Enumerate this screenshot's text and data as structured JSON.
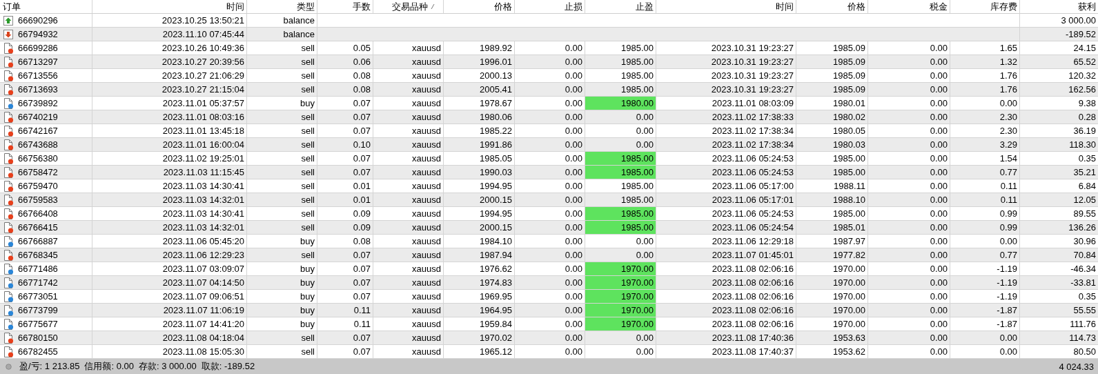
{
  "columns": [
    "订单",
    "时间",
    "类型",
    "手数",
    "交易品种",
    "价格",
    "止损",
    "止盈",
    "时间",
    "价格",
    "税金",
    "库存费",
    "获利"
  ],
  "rows": [
    {
      "kind": "deposit",
      "order": "66690296",
      "time": "2023.10.25 13:50:21",
      "type": "balance",
      "profit": "3 000.00"
    },
    {
      "kind": "withdrawal",
      "order": "66794932",
      "time": "2023.11.10 07:45:44",
      "type": "balance",
      "profit": "-189.52"
    },
    {
      "kind": "trade",
      "color": "#e8401c",
      "order": "66699286",
      "time": "2023.10.26 10:49:36",
      "type": "sell",
      "lots": "0.05",
      "symbol": "xauusd",
      "price": "1989.92",
      "sl": "0.00",
      "tp": "1985.00",
      "tp_hit": false,
      "close_time": "2023.10.31 19:23:27",
      "close_price": "1985.09",
      "tax": "0.00",
      "swap": "1.65",
      "profit": "24.15"
    },
    {
      "kind": "trade",
      "color": "#e8401c",
      "order": "66713297",
      "time": "2023.10.27 20:39:56",
      "type": "sell",
      "lots": "0.06",
      "symbol": "xauusd",
      "price": "1996.01",
      "sl": "0.00",
      "tp": "1985.00",
      "tp_hit": false,
      "close_time": "2023.10.31 19:23:27",
      "close_price": "1985.09",
      "tax": "0.00",
      "swap": "1.32",
      "profit": "65.52"
    },
    {
      "kind": "trade",
      "color": "#e8401c",
      "order": "66713556",
      "time": "2023.10.27 21:06:29",
      "type": "sell",
      "lots": "0.08",
      "symbol": "xauusd",
      "price": "2000.13",
      "sl": "0.00",
      "tp": "1985.00",
      "tp_hit": false,
      "close_time": "2023.10.31 19:23:27",
      "close_price": "1985.09",
      "tax": "0.00",
      "swap": "1.76",
      "profit": "120.32"
    },
    {
      "kind": "trade",
      "color": "#e8401c",
      "order": "66713693",
      "time": "2023.10.27 21:15:04",
      "type": "sell",
      "lots": "0.08",
      "symbol": "xauusd",
      "price": "2005.41",
      "sl": "0.00",
      "tp": "1985.00",
      "tp_hit": false,
      "close_time": "2023.10.31 19:23:27",
      "close_price": "1985.09",
      "tax": "0.00",
      "swap": "1.76",
      "profit": "162.56"
    },
    {
      "kind": "trade",
      "color": "#2a86d8",
      "order": "66739892",
      "time": "2023.11.01 05:37:57",
      "type": "buy",
      "lots": "0.07",
      "symbol": "xauusd",
      "price": "1978.67",
      "sl": "0.00",
      "tp": "1980.00",
      "tp_hit": true,
      "close_time": "2023.11.01 08:03:09",
      "close_price": "1980.01",
      "tax": "0.00",
      "swap": "0.00",
      "profit": "9.38"
    },
    {
      "kind": "trade",
      "color": "#e8401c",
      "order": "66740219",
      "time": "2023.11.01 08:03:16",
      "type": "sell",
      "lots": "0.07",
      "symbol": "xauusd",
      "price": "1980.06",
      "sl": "0.00",
      "tp": "0.00",
      "tp_hit": false,
      "close_time": "2023.11.02 17:38:33",
      "close_price": "1980.02",
      "tax": "0.00",
      "swap": "2.30",
      "profit": "0.28"
    },
    {
      "kind": "trade",
      "color": "#e8401c",
      "order": "66742167",
      "time": "2023.11.01 13:45:18",
      "type": "sell",
      "lots": "0.07",
      "symbol": "xauusd",
      "price": "1985.22",
      "sl": "0.00",
      "tp": "0.00",
      "tp_hit": false,
      "close_time": "2023.11.02 17:38:34",
      "close_price": "1980.05",
      "tax": "0.00",
      "swap": "2.30",
      "profit": "36.19"
    },
    {
      "kind": "trade",
      "color": "#e8401c",
      "order": "66743688",
      "time": "2023.11.01 16:00:04",
      "type": "sell",
      "lots": "0.10",
      "symbol": "xauusd",
      "price": "1991.86",
      "sl": "0.00",
      "tp": "0.00",
      "tp_hit": false,
      "close_time": "2023.11.02 17:38:34",
      "close_price": "1980.03",
      "tax": "0.00",
      "swap": "3.29",
      "profit": "118.30"
    },
    {
      "kind": "trade",
      "color": "#e8401c",
      "order": "66756380",
      "time": "2023.11.02 19:25:01",
      "type": "sell",
      "lots": "0.07",
      "symbol": "xauusd",
      "price": "1985.05",
      "sl": "0.00",
      "tp": "1985.00",
      "tp_hit": true,
      "close_time": "2023.11.06 05:24:53",
      "close_price": "1985.00",
      "tax": "0.00",
      "swap": "1.54",
      "profit": "0.35"
    },
    {
      "kind": "trade",
      "color": "#e8401c",
      "order": "66758472",
      "time": "2023.11.03 11:15:45",
      "type": "sell",
      "lots": "0.07",
      "symbol": "xauusd",
      "price": "1990.03",
      "sl": "0.00",
      "tp": "1985.00",
      "tp_hit": true,
      "close_time": "2023.11.06 05:24:53",
      "close_price": "1985.00",
      "tax": "0.00",
      "swap": "0.77",
      "profit": "35.21"
    },
    {
      "kind": "trade",
      "color": "#e8401c",
      "order": "66759470",
      "time": "2023.11.03 14:30:41",
      "type": "sell",
      "lots": "0.01",
      "symbol": "xauusd",
      "price": "1994.95",
      "sl": "0.00",
      "tp": "1985.00",
      "tp_hit": false,
      "close_time": "2023.11.06 05:17:00",
      "close_price": "1988.11",
      "tax": "0.00",
      "swap": "0.11",
      "profit": "6.84"
    },
    {
      "kind": "trade",
      "color": "#e8401c",
      "order": "66759583",
      "time": "2023.11.03 14:32:01",
      "type": "sell",
      "lots": "0.01",
      "symbol": "xauusd",
      "price": "2000.15",
      "sl": "0.00",
      "tp": "1985.00",
      "tp_hit": false,
      "close_time": "2023.11.06 05:17:01",
      "close_price": "1988.10",
      "tax": "0.00",
      "swap": "0.11",
      "profit": "12.05"
    },
    {
      "kind": "trade",
      "color": "#e8401c",
      "order": "66766408",
      "time": "2023.11.03 14:30:41",
      "type": "sell",
      "lots": "0.09",
      "symbol": "xauusd",
      "price": "1994.95",
      "sl": "0.00",
      "tp": "1985.00",
      "tp_hit": true,
      "close_time": "2023.11.06 05:24:53",
      "close_price": "1985.00",
      "tax": "0.00",
      "swap": "0.99",
      "profit": "89.55"
    },
    {
      "kind": "trade",
      "color": "#e8401c",
      "order": "66766415",
      "time": "2023.11.03 14:32:01",
      "type": "sell",
      "lots": "0.09",
      "symbol": "xauusd",
      "price": "2000.15",
      "sl": "0.00",
      "tp": "1985.00",
      "tp_hit": true,
      "close_time": "2023.11.06 05:24:54",
      "close_price": "1985.01",
      "tax": "0.00",
      "swap": "0.99",
      "profit": "136.26"
    },
    {
      "kind": "trade",
      "color": "#2a86d8",
      "order": "66766887",
      "time": "2023.11.06 05:45:20",
      "type": "buy",
      "lots": "0.08",
      "symbol": "xauusd",
      "price": "1984.10",
      "sl": "0.00",
      "tp": "0.00",
      "tp_hit": false,
      "close_time": "2023.11.06 12:29:18",
      "close_price": "1987.97",
      "tax": "0.00",
      "swap": "0.00",
      "profit": "30.96"
    },
    {
      "kind": "trade",
      "color": "#e8401c",
      "order": "66768345",
      "time": "2023.11.06 12:29:23",
      "type": "sell",
      "lots": "0.07",
      "symbol": "xauusd",
      "price": "1987.94",
      "sl": "0.00",
      "tp": "0.00",
      "tp_hit": false,
      "close_time": "2023.11.07 01:45:01",
      "close_price": "1977.82",
      "tax": "0.00",
      "swap": "0.77",
      "profit": "70.84"
    },
    {
      "kind": "trade",
      "color": "#2a86d8",
      "order": "66771486",
      "time": "2023.11.07 03:09:07",
      "type": "buy",
      "lots": "0.07",
      "symbol": "xauusd",
      "price": "1976.62",
      "sl": "0.00",
      "tp": "1970.00",
      "tp_hit": true,
      "close_time": "2023.11.08 02:06:16",
      "close_price": "1970.00",
      "tax": "0.00",
      "swap": "-1.19",
      "profit": "-46.34"
    },
    {
      "kind": "trade",
      "color": "#2a86d8",
      "order": "66771742",
      "time": "2023.11.07 04:14:50",
      "type": "buy",
      "lots": "0.07",
      "symbol": "xauusd",
      "price": "1974.83",
      "sl": "0.00",
      "tp": "1970.00",
      "tp_hit": true,
      "close_time": "2023.11.08 02:06:16",
      "close_price": "1970.00",
      "tax": "0.00",
      "swap": "-1.19",
      "profit": "-33.81"
    },
    {
      "kind": "trade",
      "color": "#2a86d8",
      "order": "66773051",
      "time": "2023.11.07 09:06:51",
      "type": "buy",
      "lots": "0.07",
      "symbol": "xauusd",
      "price": "1969.95",
      "sl": "0.00",
      "tp": "1970.00",
      "tp_hit": true,
      "close_time": "2023.11.08 02:06:16",
      "close_price": "1970.00",
      "tax": "0.00",
      "swap": "-1.19",
      "profit": "0.35"
    },
    {
      "kind": "trade",
      "color": "#2a86d8",
      "order": "66773799",
      "time": "2023.11.07 11:06:19",
      "type": "buy",
      "lots": "0.11",
      "symbol": "xauusd",
      "price": "1964.95",
      "sl": "0.00",
      "tp": "1970.00",
      "tp_hit": true,
      "close_time": "2023.11.08 02:06:16",
      "close_price": "1970.00",
      "tax": "0.00",
      "swap": "-1.87",
      "profit": "55.55"
    },
    {
      "kind": "trade",
      "color": "#2a86d8",
      "order": "66775677",
      "time": "2023.11.07 14:41:20",
      "type": "buy",
      "lots": "0.11",
      "symbol": "xauusd",
      "price": "1959.84",
      "sl": "0.00",
      "tp": "1970.00",
      "tp_hit": true,
      "close_time": "2023.11.08 02:06:16",
      "close_price": "1970.00",
      "tax": "0.00",
      "swap": "-1.87",
      "profit": "111.76"
    },
    {
      "kind": "trade",
      "color": "#e8401c",
      "order": "66780150",
      "time": "2023.11.08 04:18:04",
      "type": "sell",
      "lots": "0.07",
      "symbol": "xauusd",
      "price": "1970.02",
      "sl": "0.00",
      "tp": "0.00",
      "tp_hit": false,
      "close_time": "2023.11.08 17:40:36",
      "close_price": "1953.63",
      "tax": "0.00",
      "swap": "0.00",
      "profit": "114.73"
    },
    {
      "kind": "trade",
      "color": "#e8401c",
      "order": "66782455",
      "time": "2023.11.08 15:05:30",
      "type": "sell",
      "lots": "0.07",
      "symbol": "xauusd",
      "price": "1965.12",
      "sl": "0.00",
      "tp": "0.00",
      "tp_hit": false,
      "close_time": "2023.11.08 17:40:37",
      "close_price": "1953.62",
      "tax": "0.00",
      "swap": "0.00",
      "profit": "80.50"
    }
  ],
  "status_bar": {
    "items": [
      "盈/亏: 1 213.85",
      "信用额: 0.00",
      "存款: 3 000.00",
      "取款: -189.52"
    ],
    "total": "4 024.33"
  }
}
